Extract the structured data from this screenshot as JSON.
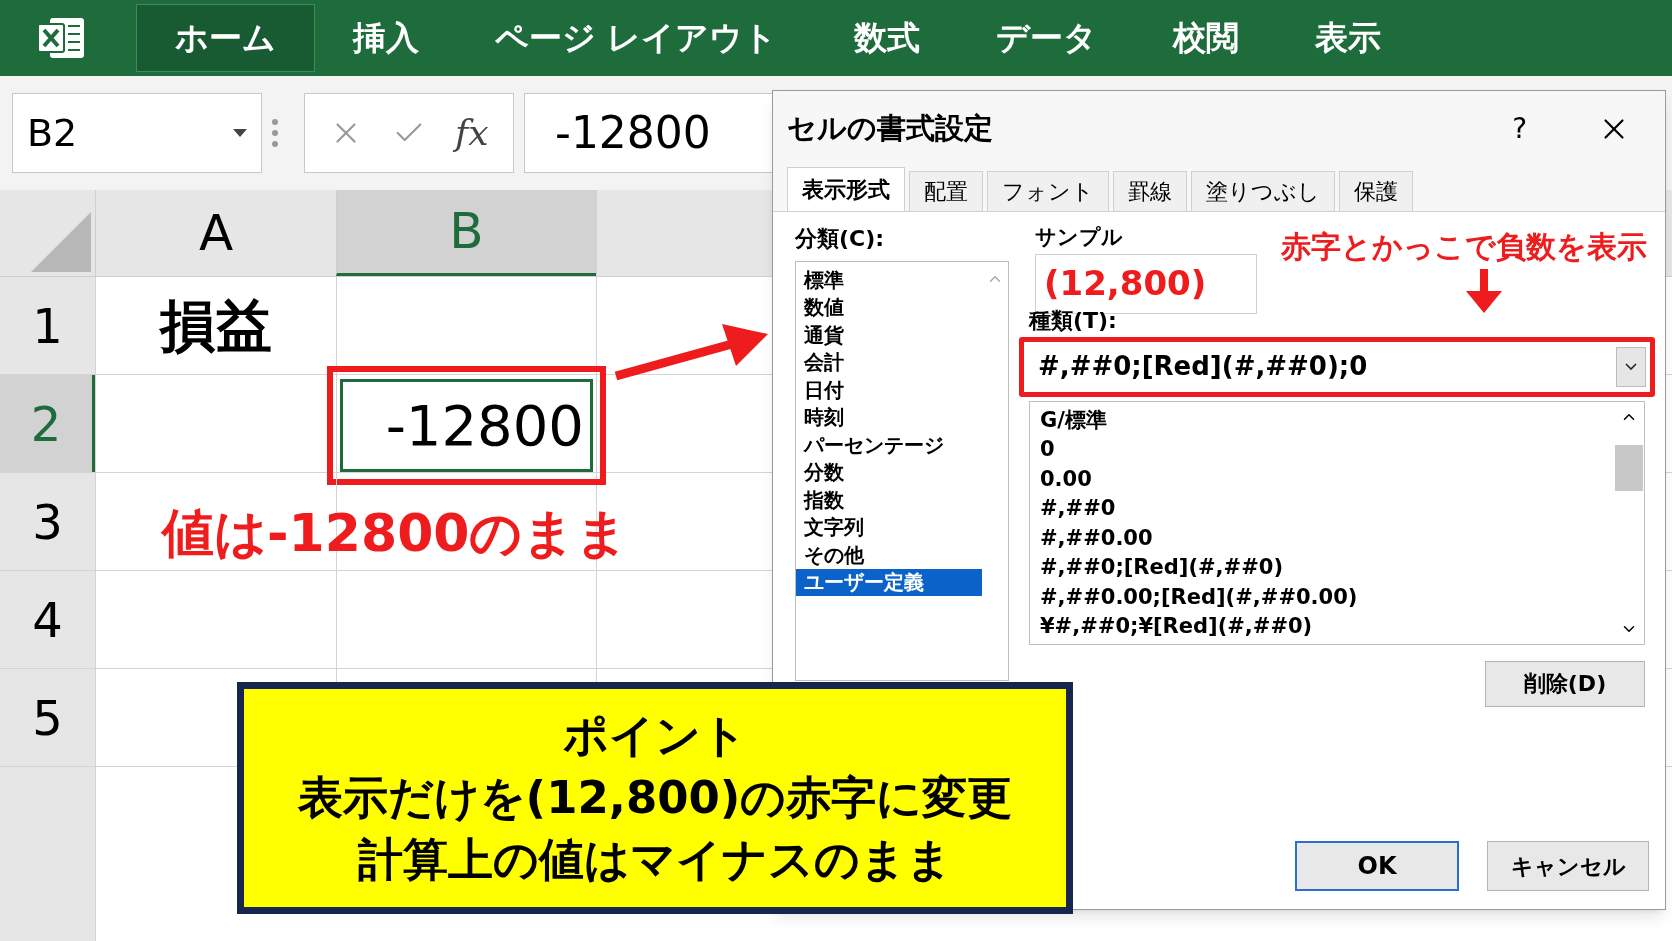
{
  "ribbon": {
    "tabs": [
      {
        "label": "ホーム",
        "selected": true
      },
      {
        "label": "挿入",
        "selected": false
      },
      {
        "label": "ページ レイアウト",
        "selected": false
      },
      {
        "label": "数式",
        "selected": false
      },
      {
        "label": "データ",
        "selected": false
      },
      {
        "label": "校閲",
        "selected": false
      },
      {
        "label": "表示",
        "selected": false
      }
    ]
  },
  "formula_bar": {
    "name_box": "B2",
    "function_label": "fx",
    "value": "-12800"
  },
  "sheet": {
    "columns": [
      {
        "label": "A",
        "selected": false
      },
      {
        "label": "B",
        "selected": true
      }
    ],
    "rows": [
      {
        "label": "1",
        "selected": false,
        "cell_a": "損益"
      },
      {
        "label": "2",
        "selected": true,
        "cell_b": "-12800"
      },
      {
        "label": "3",
        "selected": false
      },
      {
        "label": "4",
        "selected": false
      },
      {
        "label": "5",
        "selected": false
      }
    ]
  },
  "dialog": {
    "title": "セルの書式設定",
    "help": "?",
    "tabs": [
      {
        "label": "表示形式",
        "selected": true
      },
      {
        "label": "配置",
        "selected": false
      },
      {
        "label": "フォント",
        "selected": false
      },
      {
        "label": "罫線",
        "selected": false
      },
      {
        "label": "塗りつぶし",
        "selected": false
      },
      {
        "label": "保護",
        "selected": false
      }
    ],
    "category_label": "分類(C):",
    "categories": [
      {
        "label": "標準",
        "selected": false
      },
      {
        "label": "数値",
        "selected": false
      },
      {
        "label": "通貨",
        "selected": false
      },
      {
        "label": "会計",
        "selected": false
      },
      {
        "label": "日付",
        "selected": false
      },
      {
        "label": "時刻",
        "selected": false
      },
      {
        "label": "パーセンテージ",
        "selected": false
      },
      {
        "label": "分数",
        "selected": false
      },
      {
        "label": "指数",
        "selected": false
      },
      {
        "label": "文字列",
        "selected": false
      },
      {
        "label": "その他",
        "selected": false
      },
      {
        "label": "ユーザー定義",
        "selected": true
      }
    ],
    "sample_label": "サンプル",
    "sample": "(12,800)",
    "type_label": "種類(T):",
    "type_value": "#,##0;[Red](#,##0);0",
    "formats": [
      "G/標準",
      "0",
      "0.00",
      "#,##0",
      "#,##0.00",
      "#,##0;[Red](#,##0)",
      "#,##0.00;[Red](#,##0.00)",
      "¥#,##0;¥[Red](#,##0)"
    ],
    "delete_button": "削除(D)",
    "ok_button": "OK",
    "cancel_button": "キャンセル"
  },
  "annotations": {
    "cell_note": "値は-12800のまま",
    "format_note": "赤字とかっこで負数を表示",
    "callout": [
      "ポイント",
      "表示だけを(12,800)の赤字に変更",
      "計算上の値はマイナスのまま"
    ]
  }
}
